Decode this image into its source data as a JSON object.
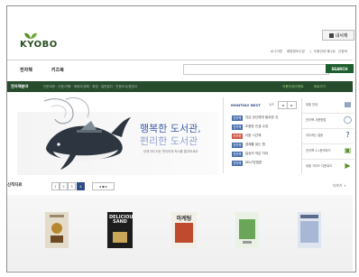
{
  "brand": {
    "logo_text": "KYOBO",
    "leaf_color": "#5a8f2a"
  },
  "header": {
    "my_library": "내서재",
    "util_links": [
      "로그아웃",
      "회원정보수정",
      "|",
      "이용안내",
      "제니트",
      "신청바"
    ]
  },
  "gnb": {
    "items": [
      "전자책",
      "키즈북"
    ]
  },
  "search": {
    "placeholder": "",
    "button": "SEARCH"
  },
  "category_bar": {
    "label": "전자책분야",
    "items": "인문교양 · 산문/기행 · 재테크/경제 · 취업 · 일반잡지 · 인문도서/경영서",
    "right_a": "이용안내/이벤트",
    "right_b": "바로가기"
  },
  "banner": {
    "headline1": "행복한 도서관,",
    "headline2": "편리한 도서관",
    "subtext": "언제 어디서든 편리하게 독서를 즐겨보세요"
  },
  "monthly_best": {
    "title": "MONTHLY BEST",
    "page": "1/3",
    "prev": "◂",
    "next": "▸",
    "items": [
      {
        "tag": "전자책",
        "text": "지금 당신에게 필요한 것"
      },
      {
        "tag": "전자책",
        "text": "조용한 인생 수업"
      },
      {
        "tag": "키즈북",
        "text": "다음 시간에"
      },
      {
        "tag": "전자책",
        "text": "경제를 읽는 힘"
      },
      {
        "tag": "전자책",
        "text": "일상의 작은 차이"
      },
      {
        "tag": "전자책",
        "text": "SELF방법론"
      }
    ]
  },
  "quick_menu": [
    {
      "label": "대출 안내",
      "icon": "📋"
    },
    {
      "label": "전자책 사용방법",
      "icon": "◯"
    },
    {
      "label": "자주하는 질문",
      "icon": "?"
    },
    {
      "label": "전자책 1:1문의하기",
      "icon": "▣"
    },
    {
      "label": "대출 가이드 다운로드",
      "icon": "▶"
    }
  ],
  "new_books": {
    "heading": "신착자료",
    "pages": [
      "1",
      "2",
      "3",
      "4"
    ],
    "active_page": "4",
    "nav": "◂ ▪ ▸",
    "more": "더보기 +",
    "books": [
      {
        "title": "",
        "color": "#d8cbb2"
      },
      {
        "title": "DELICIOUS SAND",
        "color": "#222222"
      },
      {
        "title": "마케팅",
        "color": "#c04a2e"
      },
      {
        "title": "",
        "color": "#6aa55a"
      },
      {
        "title": "",
        "color": "#a8b7d6"
      }
    ]
  }
}
